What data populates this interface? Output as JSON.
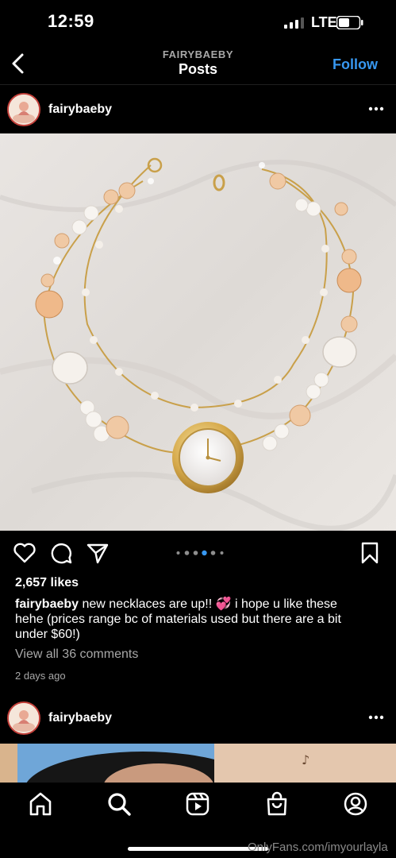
{
  "status_bar": {
    "time": "12:59",
    "network": "LTE"
  },
  "header": {
    "username": "FAIRYBAEBY",
    "title": "Posts",
    "follow_label": "Follow"
  },
  "post": {
    "username": "fairybaeby",
    "likes": "2,657 likes",
    "caption_user": "fairybaeby",
    "caption_text": "new necklaces are up!! 💞 i hope u like these hehe (prices range bc of materials used but there are a bit under $60!)",
    "view_comments": "View all 36 comments",
    "time_ago": "2 days ago",
    "carousel": {
      "count": 6,
      "active_index": 3
    }
  },
  "next_post": {
    "username": "fairybaeby"
  },
  "tab_bar": {
    "items": [
      "home",
      "search",
      "reels",
      "shop",
      "profile"
    ]
  },
  "watermark": "OnlyFans.com/imyourlayla",
  "colors": {
    "accent": "#3797f0",
    "background": "#000000",
    "muted": "#a8a8a8",
    "story_ring": "#c4403a"
  }
}
